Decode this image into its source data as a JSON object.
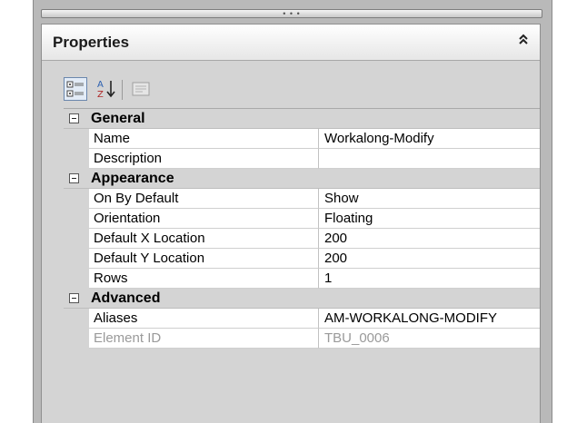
{
  "panel": {
    "title": "Properties",
    "collapse_glyph": "˄˄"
  },
  "toolbar": {
    "buttons": [
      {
        "name": "categorized-view-icon",
        "active": true
      },
      {
        "name": "alphabetical-sort-icon",
        "active": false
      },
      {
        "name": "property-pages-icon",
        "active": false,
        "disabled": true
      }
    ]
  },
  "grid": {
    "categories": [
      {
        "label": "General",
        "rows": [
          {
            "name": "Name",
            "value": "Workalong-Modify"
          },
          {
            "name": "Description",
            "value": ""
          }
        ]
      },
      {
        "label": "Appearance",
        "rows": [
          {
            "name": "On By Default",
            "value": "Show"
          },
          {
            "name": "Orientation",
            "value": "Floating"
          },
          {
            "name": "Default X Location",
            "value": "200"
          },
          {
            "name": "Default Y Location",
            "value": "200"
          },
          {
            "name": "Rows",
            "value": "1"
          }
        ]
      },
      {
        "label": "Advanced",
        "rows": [
          {
            "name": "Aliases",
            "value": "AM-WORKALONG-MODIFY"
          },
          {
            "name": "Element ID",
            "value": "TBU_0006",
            "disabled": true
          }
        ]
      }
    ]
  },
  "colors": {
    "frame": "#b9b9b9",
    "category_bg": "#d4d4d4",
    "cell_bg": "#ffffff",
    "disabled_text": "#9a9a9a"
  }
}
